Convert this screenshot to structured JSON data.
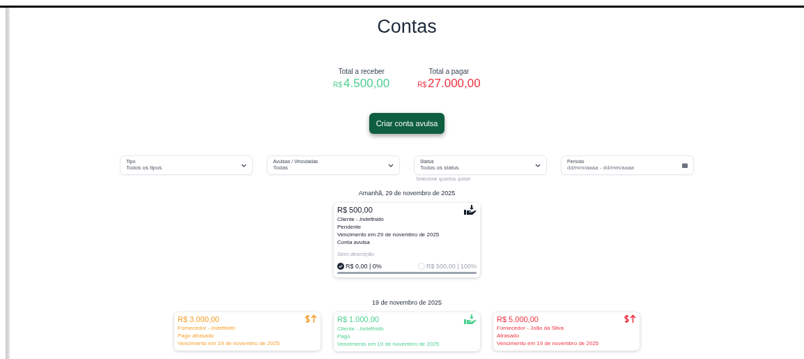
{
  "title": "Contas",
  "totals": [
    {
      "kind": "receive",
      "label": "Total a receber",
      "currency": "R$",
      "value": "4.500,00"
    },
    {
      "kind": "pay",
      "label": "Total a pagar",
      "currency": "R$",
      "value": "27.000,00"
    }
  ],
  "create_button": "Criar conta avulsa",
  "filters": [
    {
      "kind": "select",
      "label": "Tipo",
      "value": "Todos os tipos"
    },
    {
      "kind": "select",
      "label": "Avulsas / Vinculadas",
      "value": "Todas"
    },
    {
      "kind": "select",
      "label": "Status",
      "value": "Todos os status",
      "hint": "Selecione quantos quiser"
    },
    {
      "kind": "date",
      "label": "Período",
      "placeholder": "dd/mm/aaaa - dd/mm/aaaa"
    }
  ],
  "groups": [
    {
      "heading": "Amanhã, 29 de novembro de 2025",
      "cards": [
        {
          "kind": "receive",
          "color": "#111827",
          "amount": "R$ 500,00",
          "party_role": "Cliente -",
          "party": "Indefinido",
          "party_undefined": true,
          "status": "Pendente",
          "due": "Vencimento em 29 de novembro de 2025",
          "type": "Conta avulsa",
          "description_placeholder": "Sem descrição",
          "paid": {
            "text": "R$ 0,00 | 0%",
            "checked": true
          },
          "remaining": {
            "text": "R$ 500,00 | 100%",
            "checked": false
          }
        }
      ]
    },
    {
      "heading": "19 de novembro de 2025",
      "cards": [
        {
          "kind": "pay",
          "color": "#f59e2b",
          "amount": "R$ 3.000,00",
          "party_role": "Fornecedor -",
          "party": "Indefinido",
          "party_undefined": true,
          "status": "Pago atrasado",
          "due": "Vencimento em 19 de novembro de 2025"
        },
        {
          "kind": "receive",
          "color": "#4ccf8f",
          "amount": "R$ 1.000,00",
          "party_role": "Cliente -",
          "party": "Indefinido",
          "party_undefined": true,
          "status": "Pago",
          "due": "Vencimento em 19 de novembro de 2025"
        },
        {
          "kind": "pay",
          "color": "#ef2f3f",
          "amount": "R$ 5.000,00",
          "party_role": "Fornecedor -",
          "party": "João da Silva",
          "party_undefined": false,
          "status": "Atrasado",
          "due": "Vencimento em 19 de novembro de 2025"
        }
      ]
    }
  ]
}
